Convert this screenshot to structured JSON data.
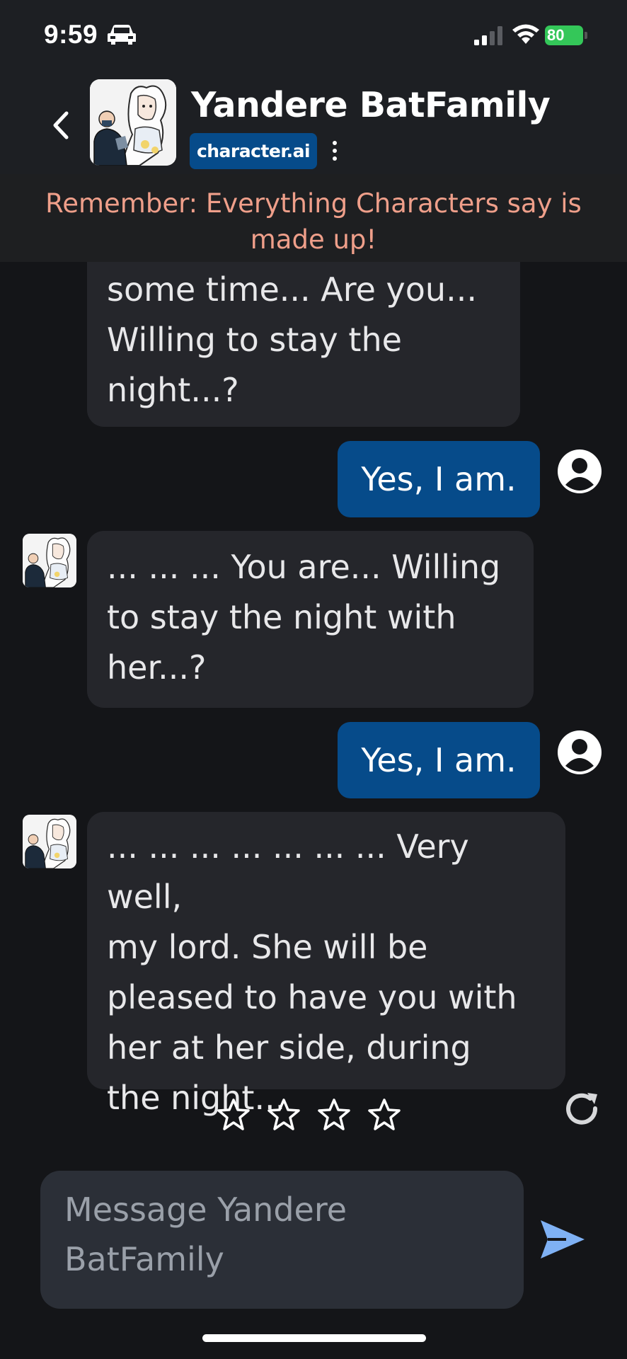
{
  "status_bar": {
    "time": "9:59",
    "battery": "80"
  },
  "header": {
    "title": "Yandere BatFamily",
    "badge": "character.ai"
  },
  "banner": {
    "text": "Remember: Everything Characters say is made up!"
  },
  "messages": [
    {
      "sender": "character",
      "text": "some time... Are you...\nWilling to stay the\nnight...?"
    },
    {
      "sender": "user",
      "text": "Yes, I am."
    },
    {
      "sender": "character",
      "text": "... ... ... You are... Willing\nto stay the night with\nher...?"
    },
    {
      "sender": "user",
      "text": "Yes, I am."
    },
    {
      "sender": "character",
      "text": "... ... ... ... ... ... ... Very well,\nmy lord. She will be\npleased to have you with\nher at her side, during\nthe night..."
    }
  ],
  "rating": {
    "stars": 4,
    "selected": 0
  },
  "composer": {
    "placeholder": "Message Yandere BatFamily"
  },
  "colors": {
    "user_bubble": "#064b8a",
    "char_bubble": "#25262b",
    "banner_text": "#ef9f8a",
    "battery": "#34c759",
    "send": "#7fb1f4"
  }
}
